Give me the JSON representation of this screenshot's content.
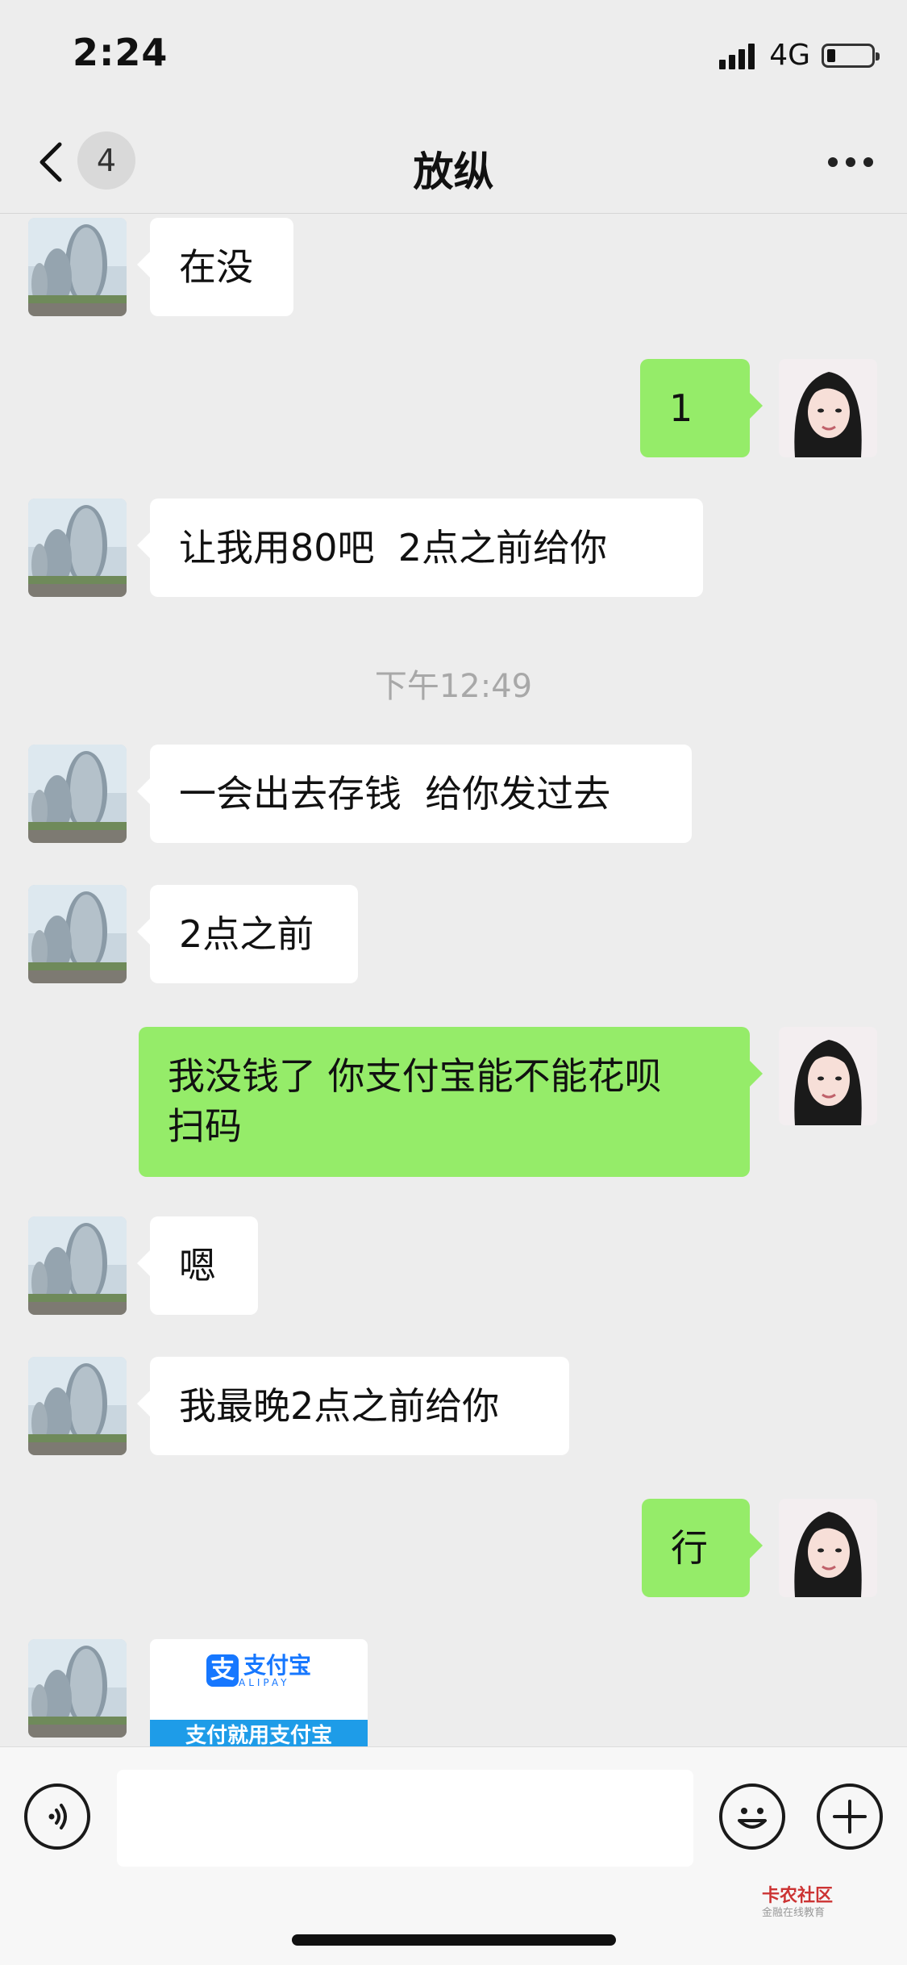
{
  "status_bar": {
    "time": "2:24",
    "network": "4G"
  },
  "header": {
    "back_count": "4",
    "title": "放纵"
  },
  "messages": [
    {
      "side": "in",
      "text": "在没"
    },
    {
      "side": "out",
      "text": "1"
    },
    {
      "side": "in",
      "text": "让我用80吧  2点之前给你"
    },
    {
      "side": "time",
      "text": "下午12:49"
    },
    {
      "side": "in",
      "text": "一会出去存钱  给你发过去"
    },
    {
      "side": "in",
      "text": "2点之前"
    },
    {
      "side": "out",
      "text": "我没钱了 你支付宝能不能花呗\n扫码"
    },
    {
      "side": "in",
      "text": "嗯"
    },
    {
      "side": "in",
      "text": "我最晚2点之前给你"
    },
    {
      "side": "out",
      "text": "行"
    }
  ],
  "alipay_card": {
    "logo_char": "支",
    "name": "支付宝",
    "sub": "ALIPAY",
    "banner": "支付就用支付宝"
  },
  "watermark": {
    "title": "卡农社区",
    "sub": "金融在线教育"
  }
}
